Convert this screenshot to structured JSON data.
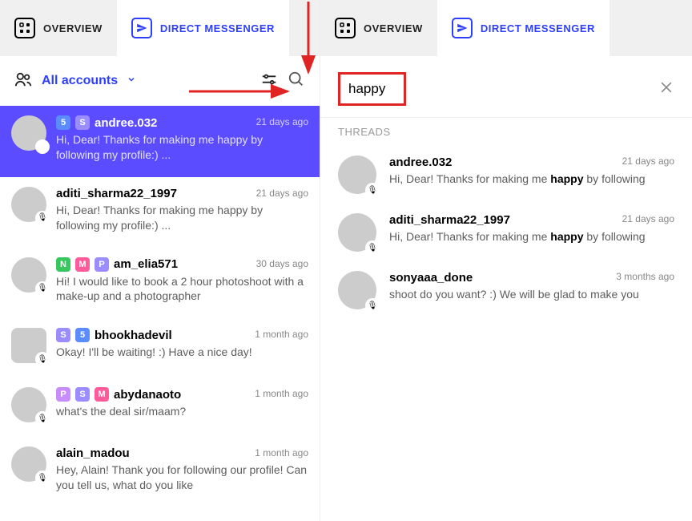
{
  "left": {
    "tabs": {
      "overview": "OVERVIEW",
      "direct": "DIRECT MESSENGER"
    },
    "filter": {
      "accounts_label": "All accounts"
    },
    "conversations": [
      {
        "tags": [
          "5",
          "S"
        ],
        "user": "andree.032",
        "snippet": "Hi, Dear! Thanks for making me happy by following my profile:) ...",
        "time": "21 days ago",
        "selected": true
      },
      {
        "tags": [],
        "user": "aditi_sharma22_1997",
        "snippet": "Hi, Dear! Thanks for making me happy by following my profile:) ...",
        "time": "21 days ago"
      },
      {
        "tags": [
          "N",
          "M",
          "P"
        ],
        "user": "am_elia571",
        "snippet": "Hi! I would like to book a 2 hour photoshoot with a make-up and a photographer",
        "time": "30 days ago"
      },
      {
        "tags": [
          "S",
          "5"
        ],
        "user": "bhookhadevil",
        "snippet": "Okay! I'll be waiting! :) Have a nice day!",
        "time": "1 month ago"
      },
      {
        "tags": [
          "P",
          "S",
          "M"
        ],
        "user": "abydanaoto",
        "snippet": "what's the deal sir/maam?",
        "time": "1 month ago"
      },
      {
        "tags": [],
        "user": "alain_madou",
        "snippet": "Hey, Alain! Thank you for following our profile! Can you tell us, what do you like",
        "time": "1 month ago"
      }
    ]
  },
  "right": {
    "tabs": {
      "overview": "OVERVIEW",
      "direct": "DIRECT MESSENGER"
    },
    "search": {
      "value": "happy",
      "section_title": "THREADS"
    },
    "threads": [
      {
        "user": "andree.032",
        "snippet_pre": "Hi, Dear! Thanks for making me ",
        "snippet_hl": "happy",
        "snippet_post": " by following",
        "time": "21 days ago"
      },
      {
        "user": "aditi_sharma22_1997",
        "snippet_pre": "Hi, Dear! Thanks for making me ",
        "snippet_hl": "happy",
        "snippet_post": " by following",
        "time": "21 days ago"
      },
      {
        "user": "sonyaaa_done",
        "snippet_pre": "shoot do you want? :) We will be glad to make you",
        "snippet_hl": "",
        "snippet_post": "",
        "time": "3 months ago"
      }
    ]
  }
}
